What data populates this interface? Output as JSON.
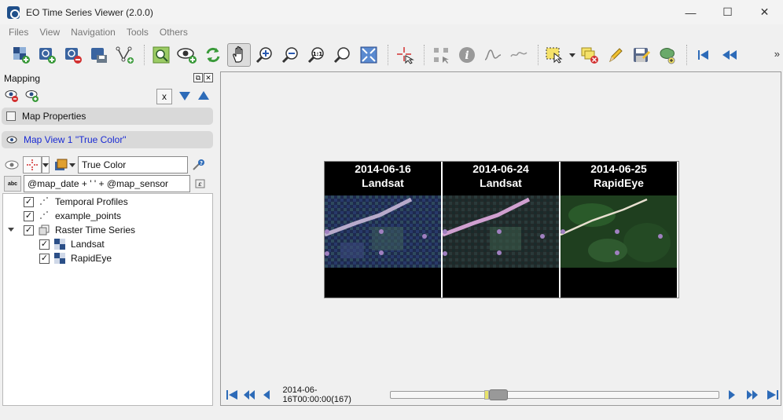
{
  "window": {
    "title": "EO Time Series Viewer (2.0.0)",
    "controls": [
      "—",
      "☐",
      "✕"
    ]
  },
  "menu": [
    "Files",
    "View",
    "Navigation",
    "Tools",
    "Others"
  ],
  "toolbar": {
    "buttons": [
      "add-raster-icon",
      "add-time-series-icon",
      "remove-time-series-icon",
      "save-time-series-icon",
      "add-vector-icon",
      "zoom-to-full-extent-icon",
      "add-map-view-icon",
      "refresh-icon",
      "pan-hand-icon",
      "zoom-in-icon",
      "zoom-out-icon",
      "zoom-native-res-icon",
      "zoom-to-extent-icon",
      "select-center-icon",
      "crosshair-icon",
      "identify-info-icon",
      "temporal-profile-icon",
      "spectral-profile-icon",
      "select-feature-icon",
      "deselect-feature-icon",
      "edit-pencil-icon",
      "save-edits-icon",
      "add-feature-icon",
      "first-date-icon",
      "previous-date-icon"
    ],
    "overflow": "»"
  },
  "dock": {
    "title": "Mapping",
    "x_label": "x",
    "map_properties": "Map Properties",
    "map_view": "Map View 1 \"True Color\"",
    "band_combo": "True Color",
    "label_expression": "@map_date + ' ' + @map_sensor",
    "tree": [
      {
        "label": "Temporal Profiles",
        "checked": true,
        "level": 0
      },
      {
        "label": "example_points",
        "checked": true,
        "level": 0
      },
      {
        "label": "Raster Time Series",
        "checked": true,
        "level": 0,
        "expanded": true
      },
      {
        "label": "Landsat",
        "checked": true,
        "level": 1
      },
      {
        "label": "RapidEye",
        "checked": true,
        "level": 1
      }
    ]
  },
  "maps": [
    {
      "date": "2014-06-16",
      "sensor": "Landsat"
    },
    {
      "date": "2014-06-24",
      "sensor": "Landsat"
    },
    {
      "date": "2014-06-25",
      "sensor": "RapidEye"
    }
  ],
  "navigation": {
    "current_date": "2014-06-16T00:00:00(167)",
    "slider_position": 0.3
  },
  "colors": {
    "accent_blue": "#1a2bd4",
    "nav_blue": "#2d6bb8"
  }
}
